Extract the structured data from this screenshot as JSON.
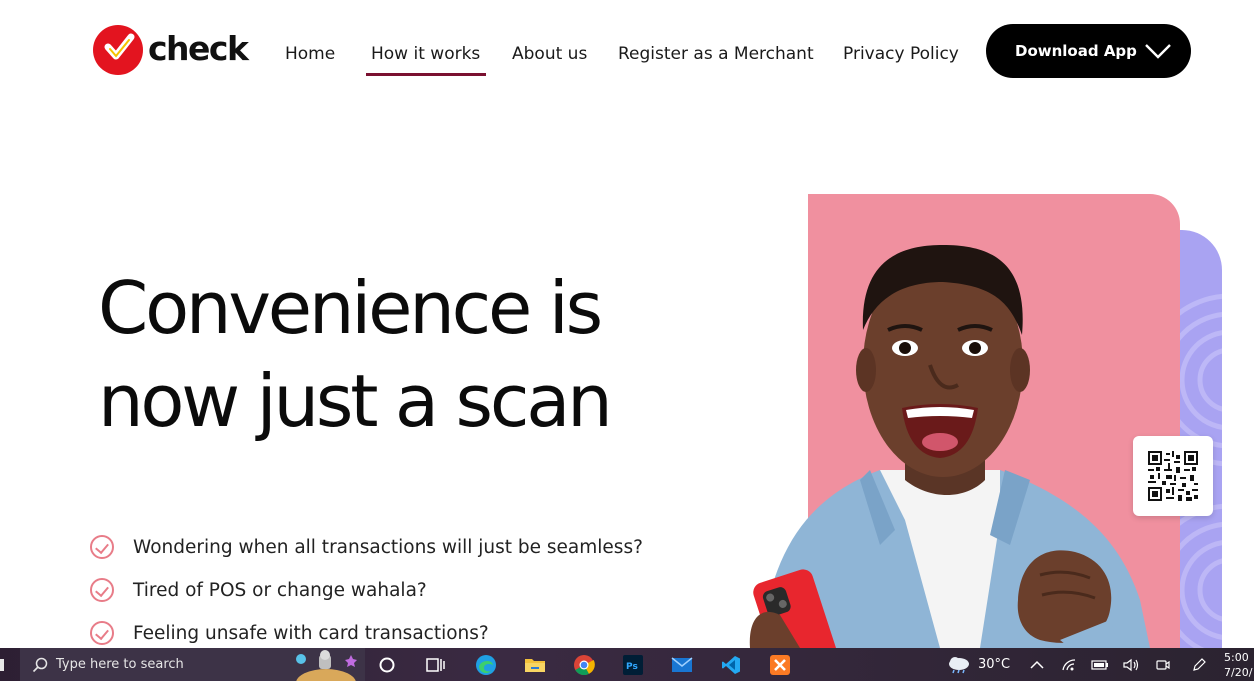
{
  "brand": {
    "name": "check",
    "accent": "#e3141f",
    "nav_underline": "#7a1030"
  },
  "nav": {
    "items": [
      {
        "label": "Home",
        "active": false
      },
      {
        "label": "How it works",
        "active": true
      },
      {
        "label": "About us",
        "active": false
      },
      {
        "label": "Register as a Merchant",
        "active": false
      },
      {
        "label": "Privacy Policy",
        "active": false
      }
    ],
    "download_label": "Download App"
  },
  "hero": {
    "title_line1": "Convenience is",
    "title_line2": "now just a scan",
    "features": [
      "Wondering when all transactions will just be seamless?",
      "Tired of POS or change wahala?",
      "Feeling unsafe with card transactions?"
    ],
    "panel_color": "#f0909f",
    "accent_panel_color": "#a9a3f2"
  },
  "taskbar": {
    "search_placeholder": "Type here to search",
    "apps": [
      "task-view",
      "edge",
      "file-explorer",
      "chrome",
      "photoshop",
      "mail",
      "vscode",
      "xampp"
    ],
    "weather": "30°C",
    "clock_time": "5:00",
    "clock_date": "7/20/"
  }
}
